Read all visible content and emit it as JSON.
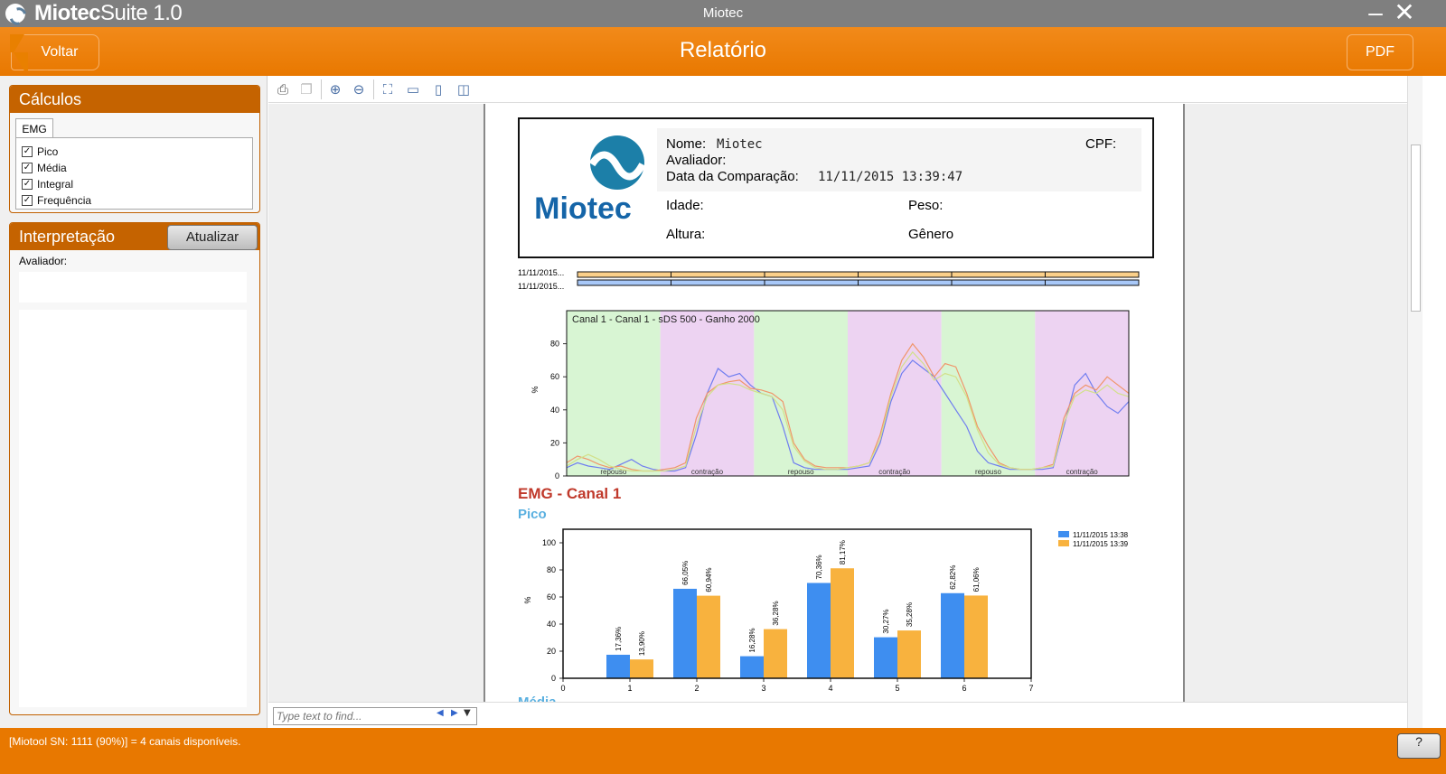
{
  "titlebar": {
    "app_name_bold": "Miotec",
    "app_name_rest": "Suite 1.0",
    "window_title": "Miotec",
    "minimize": "–",
    "close": "✕"
  },
  "header": {
    "back_label": "Voltar",
    "title": "Relatório",
    "pdf_label": "PDF"
  },
  "calculos": {
    "title": "Cálculos",
    "tab": "EMG",
    "items": [
      {
        "label": "Pico",
        "checked": true
      },
      {
        "label": "Média",
        "checked": true
      },
      {
        "label": "Integral",
        "checked": true
      },
      {
        "label": "Frequência",
        "checked": true
      }
    ]
  },
  "interpretacao": {
    "title": "Interpretação",
    "update_label": "Atualizar",
    "avaliador_label": "Avaliador:"
  },
  "toolbar": {
    "icons": [
      "print-icon",
      "copy-icon",
      "zoom-in-icon",
      "zoom-out-icon",
      "fit-page-icon",
      "fit-width-icon",
      "single-page-icon",
      "two-page-icon"
    ]
  },
  "report": {
    "nome_label": "Nome:",
    "nome_value": "Miotec",
    "cpf_label": "CPF:",
    "avaliador_label": "Avaliador:",
    "data_label": "Data da Comparação:",
    "data_value": "11/11/2015 13:39:47",
    "idade_label": "Idade:",
    "peso_label": "Peso:",
    "altura_label": "Altura:",
    "genero_label": "Gênero",
    "logo_text": "Miotec",
    "timeline_labels": [
      "11/11/2015...",
      "11/11/2015..."
    ],
    "section_title": "EMG - Canal 1",
    "sub_title": "Pico",
    "next_sub_title": "Média"
  },
  "chart_data": [
    {
      "type": "line",
      "title": "Canal 1 - Canal 1 - sDS 500 - Ganho 2000",
      "ylabel": "%",
      "ylim": [
        0,
        100
      ],
      "yticks": [
        0,
        20,
        40,
        60,
        80
      ],
      "phases": [
        "repouso",
        "contração",
        "repouso",
        "contração",
        "repouso",
        "contração"
      ],
      "phase_colors": [
        "#d8f5d3",
        "#edd3f2"
      ],
      "series": [
        {
          "color": "#6f7df0",
          "values": [
            5,
            8,
            6,
            5,
            4,
            7,
            10,
            6,
            4,
            3,
            3,
            5,
            25,
            50,
            65,
            60,
            62,
            55,
            50,
            48,
            30,
            8,
            5,
            4,
            4,
            4,
            4,
            5,
            6,
            20,
            45,
            62,
            70,
            65,
            60,
            50,
            40,
            30,
            15,
            8,
            6,
            4,
            4,
            4,
            4,
            5,
            30,
            55,
            62,
            50,
            42,
            38,
            45
          ]
        },
        {
          "color": "#f0956a",
          "values": [
            8,
            12,
            10,
            7,
            5,
            6,
            4,
            3,
            3,
            4,
            5,
            8,
            35,
            50,
            55,
            57,
            58,
            53,
            52,
            50,
            45,
            20,
            10,
            6,
            5,
            5,
            5,
            6,
            8,
            25,
            50,
            70,
            80,
            72,
            60,
            68,
            66,
            50,
            30,
            18,
            8,
            5,
            4,
            4,
            5,
            7,
            35,
            50,
            55,
            52,
            60,
            55,
            50
          ]
        },
        {
          "color": "#d2e08a",
          "values": [
            6,
            10,
            13,
            10,
            6,
            4,
            3,
            3,
            3,
            3,
            4,
            6,
            30,
            48,
            55,
            56,
            55,
            52,
            50,
            48,
            40,
            18,
            9,
            5,
            4,
            4,
            5,
            6,
            8,
            22,
            48,
            66,
            75,
            68,
            58,
            62,
            60,
            48,
            28,
            14,
            7,
            5,
            4,
            4,
            5,
            6,
            32,
            48,
            52,
            50,
            55,
            50,
            48
          ]
        }
      ]
    },
    {
      "type": "bar",
      "ylabel": "%",
      "ylim": [
        0,
        110
      ],
      "yticks": [
        0,
        20,
        40,
        60,
        80,
        100
      ],
      "xlim": [
        0,
        7
      ],
      "categories": [
        1,
        2,
        3,
        4,
        5,
        6
      ],
      "series": [
        {
          "name": "11/11/2015 13:38",
          "color": "#3e8ef0",
          "values": [
            17.36,
            66.05,
            16.28,
            70.36,
            30.27,
            62.82
          ],
          "labels": [
            "17,36%",
            "66,05%",
            "16,28%",
            "70,36%",
            "30,27%",
            "62,82%"
          ]
        },
        {
          "name": "11/11/2015 13:39",
          "color": "#f8b23e",
          "values": [
            13.9,
            60.94,
            36.28,
            81.17,
            35.28,
            61.06
          ],
          "labels": [
            "13,90%",
            "60,94%",
            "36,28%",
            "81,17%",
            "35,28%",
            "61,06%"
          ]
        }
      ]
    }
  ],
  "findbar": {
    "placeholder": "Type text to find..."
  },
  "status": {
    "text": "[Miotool SN: 1111 (90%)] = 4 canais disponíveis.",
    "help_label": "?"
  }
}
